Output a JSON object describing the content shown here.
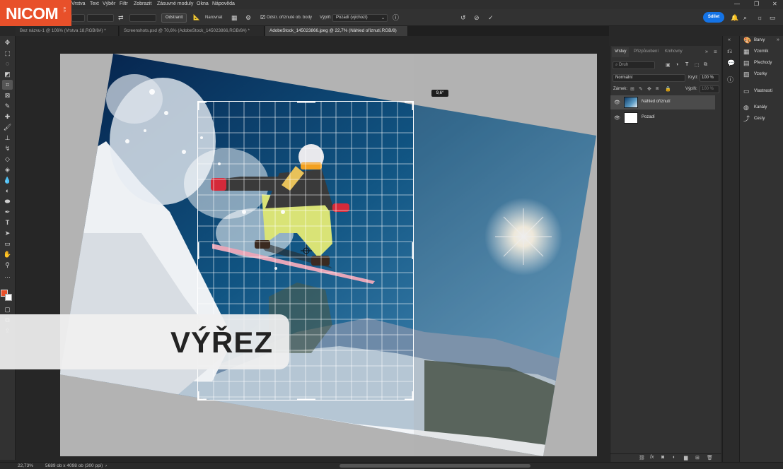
{
  "logo": {
    "text": "NICOM",
    "sub": "a.s."
  },
  "menubar": {
    "items": [
      "Vrstva",
      "Text",
      "Výběr",
      "Filtr",
      "Zobrazit",
      "Zásuvné moduly",
      "Okna",
      "Nápověda"
    ]
  },
  "window_controls": [
    "minimize-icon",
    "restore-icon",
    "close-icon"
  ],
  "options": {
    "clear_label": "Odstranit",
    "straighten_label": "Narovnat",
    "delete_cropped_label": "Odstr. oříznuté ob. body",
    "delete_cropped_checked": true,
    "fill_label": "Výplň:",
    "fill_value": "Pozadí (výchozí)",
    "share_label": "Sdílet"
  },
  "tabs": [
    {
      "label": "Bez názvu-1 @ 106% (Vrstva 18,RGB/8#) *"
    },
    {
      "label": "Screenshots.psd @ 70,6% (AdobeStock_145023866,RGB/8#) *"
    },
    {
      "label": "AdobeStock_145023866.jpeg @ 22,7% (Náhled oříznutí,RGB/8)",
      "active": true
    }
  ],
  "canvas": {
    "angle_readout": "9,6°",
    "banner_text": "VÝŘEZ"
  },
  "layers_panel": {
    "tabs": [
      "Vrstvy",
      "Přizpůsobení",
      "Knihovny"
    ],
    "search_placeholder": "Druh",
    "blend_mode": "Normální",
    "opacity_label": "Krytí:",
    "opacity_value": "100 %",
    "lock_label": "Zámek:",
    "fill_label": "Výplň:",
    "fill_value": "100 %",
    "layers": [
      {
        "name": "Náhled oříznutí",
        "selected": true
      },
      {
        "name": "Pozadí",
        "selected": false
      }
    ]
  },
  "right_panel": {
    "items": [
      {
        "label": "Barvy",
        "icon": "color-icon"
      },
      {
        "label": "Vzorník",
        "icon": "swatches-icon"
      },
      {
        "label": "Přechody",
        "icon": "gradient-icon"
      },
      {
        "label": "Vzorky",
        "icon": "patterns-icon"
      },
      {
        "label": "Vlastnosti",
        "icon": "properties-icon"
      },
      {
        "label": "Kanály",
        "icon": "channels-icon"
      },
      {
        "label": "Cesty",
        "icon": "paths-icon"
      }
    ]
  },
  "statusbar": {
    "zoom": "22,73%",
    "doc_info": "5689 ob x 4098 ob (300 ppi)"
  },
  "colors": {
    "accent": "#1473e6",
    "brand": "#e8502a",
    "foreground_swatch": "#e8502a",
    "background_swatch": "#ffffff"
  }
}
